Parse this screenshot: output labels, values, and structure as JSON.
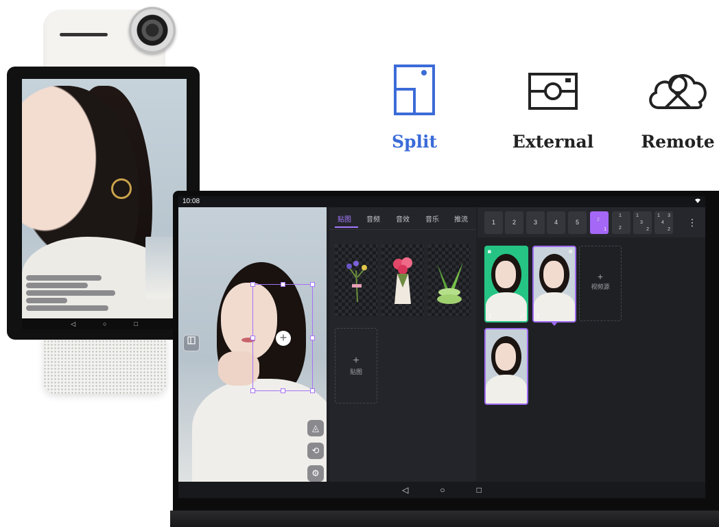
{
  "modes": [
    {
      "label": "Split",
      "icon": "split-layout-icon",
      "color": "#3b6bd8"
    },
    {
      "label": "External",
      "icon": "external-camera-icon",
      "color": "#222222"
    },
    {
      "label": "Remote",
      "icon": "cloud-remote-icon",
      "color": "#222222"
    }
  ],
  "tablet": {
    "status": {
      "time": "10:08",
      "wifi_icon": "wifi-icon"
    },
    "mid_tabs": [
      "贴图",
      "音频",
      "音效",
      "音乐",
      "推流"
    ],
    "active_tab": "贴图",
    "stickers": [
      {
        "icon": "flower-bouquet-sticker"
      },
      {
        "icon": "roses-vase-sticker"
      },
      {
        "icon": "aloe-sticker"
      }
    ],
    "add_sticker": {
      "plus": "+",
      "label": "贴图"
    },
    "layout_buttons": [
      "1",
      "2",
      "3",
      "4",
      "5"
    ],
    "layout_presets": [
      {
        "cells": [
          "2",
          "1"
        ],
        "active": true
      },
      {
        "cells": [
          "1",
          "2"
        ],
        "active": false
      },
      {
        "cells": [
          "1",
          "3",
          "2"
        ],
        "active": false
      },
      {
        "cells": [
          "1",
          "3",
          "4",
          "2"
        ],
        "active": false
      }
    ],
    "more_icon": "⋮",
    "sources": [
      {
        "num": "1",
        "bg": "#25c484"
      },
      {
        "num": "2",
        "bg": "#c9d3db"
      },
      {
        "num": "",
        "bg": "#c6d0d8"
      }
    ],
    "add_source": {
      "plus": "+",
      "label": "视频源"
    },
    "nav": {
      "back": "◁",
      "home": "○",
      "recent": "□"
    },
    "accent": "#a567f6"
  },
  "portrait": {
    "nav": {
      "back": "◁",
      "home": "○",
      "recent": "□"
    }
  }
}
